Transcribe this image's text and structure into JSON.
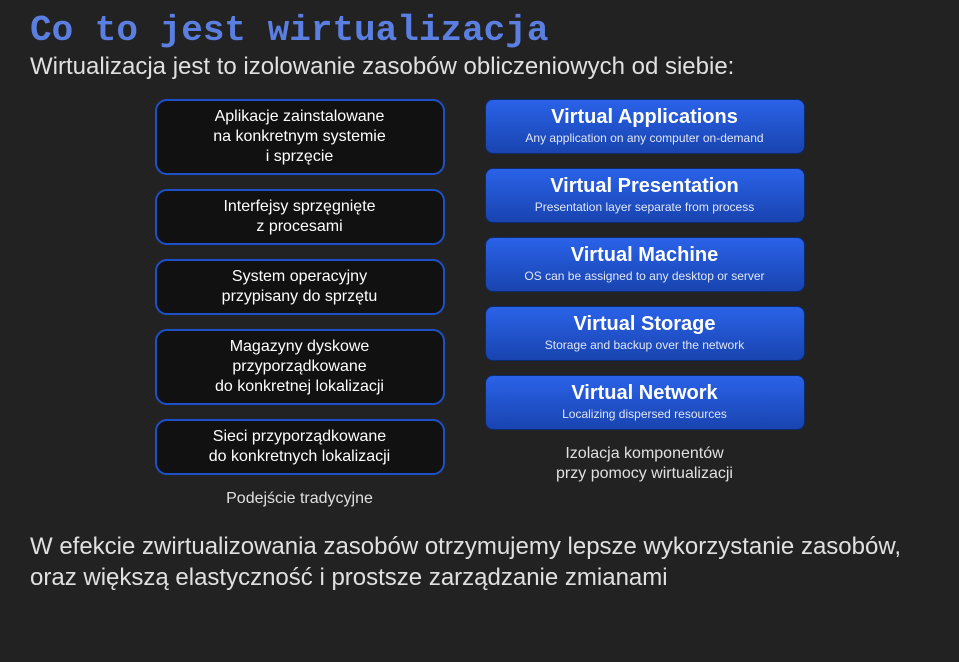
{
  "title": "Co to jest wirtualizacja",
  "subtitle": "Wirtualizacja jest to izolowanie zasobów obliczeniowych od siebie:",
  "left_boxes": [
    "Aplikacje zainstalowane\nna konkretnym systemie\ni sprzęcie",
    "Interfejsy sprzęgnięte\nz procesami",
    "System operacyjny\nprzypisany do sprzętu",
    "Magazyny dyskowe\nprzyporządkowane\ndo konkretnej lokalizacji",
    "Sieci przyporządkowane\ndo konkretnych lokalizacji"
  ],
  "left_caption": "Podejście tradycyjne",
  "right_boxes": [
    {
      "title": "Virtual Applications",
      "sub": "Any application on any computer on-demand"
    },
    {
      "title": "Virtual Presentation",
      "sub": "Presentation layer separate from process"
    },
    {
      "title": "Virtual Machine",
      "sub": "OS can be assigned to any desktop or server"
    },
    {
      "title": "Virtual Storage",
      "sub": "Storage and backup over the network"
    },
    {
      "title": "Virtual Network",
      "sub": "Localizing dispersed resources"
    }
  ],
  "right_caption": "Izolacja komponentów\nprzy pomocy wirtualizacji",
  "conclusion": "W efekcie zwirtualizowania zasobów otrzymujemy lepsze wykorzystanie zasobów, oraz większą elastyczność i prostsze zarządzanie zmianami"
}
